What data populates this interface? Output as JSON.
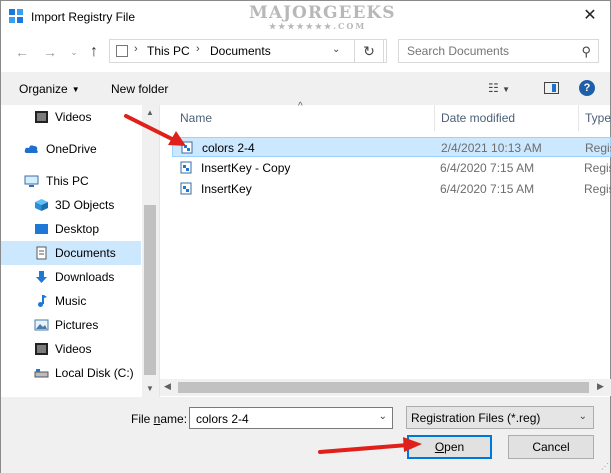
{
  "window": {
    "title": "Import Registry File",
    "watermark_main": "MAJORGEEKS",
    "watermark_sub": "★★★★★★★.COM"
  },
  "address_bar": {
    "crumbs": [
      "This PC",
      "Documents"
    ],
    "search_placeholder": "Search Documents"
  },
  "toolbar": {
    "organize": "Organize",
    "new_folder": "New folder",
    "help": "?"
  },
  "nav": {
    "items": [
      {
        "label": "Videos",
        "icon": "video-icon"
      },
      {
        "label": "OneDrive",
        "icon": "cloud-icon"
      },
      {
        "label": "This PC",
        "icon": "computer-icon"
      },
      {
        "label": "3D Objects",
        "icon": "cube-icon"
      },
      {
        "label": "Desktop",
        "icon": "desktop-icon"
      },
      {
        "label": "Documents",
        "icon": "document-icon",
        "selected": true
      },
      {
        "label": "Downloads",
        "icon": "download-arrow-icon"
      },
      {
        "label": "Music",
        "icon": "music-note-icon"
      },
      {
        "label": "Pictures",
        "icon": "picture-icon"
      },
      {
        "label": "Videos",
        "icon": "video-icon"
      },
      {
        "label": "Local Disk (C:)",
        "icon": "drive-icon"
      }
    ]
  },
  "files": {
    "columns": [
      "Name",
      "Date modified",
      "Type"
    ],
    "rows": [
      {
        "name": "colors 2-4",
        "date": "2/4/2021 10:13 AM",
        "type": "Regis",
        "selected": true
      },
      {
        "name": "InsertKey - Copy",
        "date": "6/4/2020 7:15 AM",
        "type": "Regis"
      },
      {
        "name": "InsertKey",
        "date": "6/4/2020 7:15 AM",
        "type": "Regis"
      }
    ]
  },
  "bottom": {
    "file_name_label_underlined": "n",
    "file_name_label_pre": "File ",
    "file_name_label_post": "ame:",
    "file_name_value": "colors 2-4",
    "file_type": "Registration Files (*.reg)",
    "open_underlined": "O",
    "open_rest": "pen",
    "cancel": "Cancel"
  },
  "colors": {
    "selection": "#cce8ff",
    "selection_border": "#99d1ff",
    "accent": "#0078d7",
    "annotation_arrow": "#e0201b"
  }
}
